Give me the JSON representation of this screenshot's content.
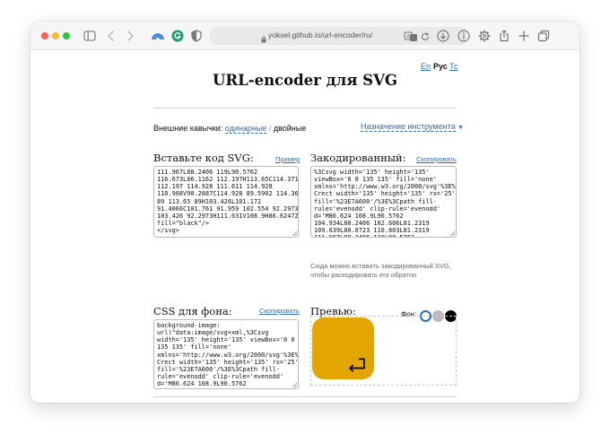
{
  "browser": {
    "url": "yoksel.github.io/url-encoder/ru/"
  },
  "page": {
    "languages": [
      {
        "label": "En",
        "active": false
      },
      {
        "label": "Рус",
        "active": true
      },
      {
        "label": "Тс",
        "active": false
      }
    ],
    "title": "URL-encoder для SVG",
    "quotes": {
      "label": "Внешние кавычки:",
      "single": "одинарные",
      "separator": "/",
      "double": "двойные"
    },
    "purpose_link": "Назначение инструмента",
    "insert": {
      "title": "Вставьте код SVG:",
      "example_link": "Пример",
      "code": "111.967L88.2406 119L90.5762\n116.673L86.1162 112.197H113.65C114.371\n112.197 114.928 111.611 114.928\n110.908V90.2887C114.928 89.5902 114.361\n89 113.65 89H103.426L101.172\n91.4066C101.761 91.959 102.554 92.2973\n103.426 92.2973H111.631V108.9H86.6247Z\"\nfill=\"black\"/>\n</svg>"
    },
    "encoded": {
      "title": "Закодированный:",
      "copy_link": "Скопировать",
      "code": "%3Csvg width='135' height='135'\nviewBox='0 0 135 135' fill='none'\nxmlns='http://www.w3.org/2000/svg'%3E%3\nCrect width='135' height='135' rx='25'\nfill='%23E7A600'/%3E%3Cpath fill-\nrule='evenodd' clip-rule='evenodd'\nd='M86.624 108.9L90.5762\n104.934L88.2406 102.606L81.2319\n109.639L80.0723 110.803L81.2319\n111.967L88.2406 119L90.5762",
      "hint": "Сюда можно вставить закодированный SVG, чтобы раскодировать его обратно"
    },
    "css": {
      "title": "CSS для фона:",
      "copy_link": "Скопировать",
      "code": "background-image:\nurl(\"data:image/svg+xml,%3Csvg\nwidth='135' height='135' viewBox='0 0\n135 135' fill='none'\nxmlns='http://www.w3.org/2000/svg'%3E%3\nCrect width='135' height='135' rx='25'\nfill='%23E7A600'/%3E%3Cpath fill-\nrule='evenodd' clip-rule='evenodd'\nd='M86.624 108.9L90.5762\n104.934L88.2406 102.606L81.2319"
    },
    "preview": {
      "title": "Превью:",
      "bg_label": "Фон:",
      "swatches": [
        {
          "color": "#ffffff",
          "selected": true
        },
        {
          "color": "#bbbbbb",
          "selected": false
        },
        {
          "color": "#000000",
          "selected": false
        }
      ],
      "tile_color": "#E3A600",
      "icon": "return-arrow-icon"
    }
  }
}
